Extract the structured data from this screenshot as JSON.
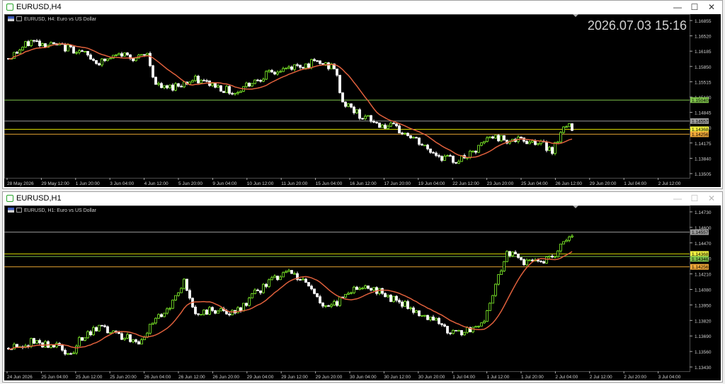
{
  "colors": {
    "bull": "#7ff02a",
    "bear": "#ffffff",
    "ma": "#e0603c",
    "bg": "#000000",
    "grid": "#4a4a4a",
    "green_line": "#7ec24a",
    "orange_line": "#e0a030",
    "gray_line": "#9a9a9a"
  },
  "windows": [
    {
      "title": "EURUSD,H4",
      "symbol_info": "EURUSD, H4:  Euro vs US Dollar",
      "clock": "2026.07.03 15:16",
      "controls": {
        "min": "—",
        "max": "☐",
        "close": "✕"
      },
      "price_axis": [
        "1.16855",
        "1.16520",
        "1.16185",
        "1.15850",
        "1.15515",
        "1.15180",
        "1.14845",
        "1.14510",
        "1.14175",
        "1.13840",
        "1.13505"
      ],
      "price_range": [
        1.1325,
        1.1697
      ],
      "time_labels": [
        "28 May 2026",
        "29 May 12:00",
        "1 Jun 20:00",
        "3 Jun 04:00",
        "4 Jun 12:00",
        "5 Jun 20:00",
        "9 Jun 04:00",
        "10 Jun 12:00",
        "11 Jun 20:00",
        "15 Jun 04:00",
        "16 Jun 12:00",
        "17 Jun 20:00",
        "19 Jun 04:00",
        "22 Jun 12:00",
        "23 Jun 20:00",
        "25 Jun 04:00",
        "26 Jun 12:00",
        "29 Jun 20:00",
        "1 Jul 04:00",
        "2 Jul 12:00"
      ],
      "levels": [
        {
          "price": 1.1504,
          "label": "1.15040",
          "color": "#7ec24a",
          "label_bg": "#7ec24a",
          "label_fg": "#000"
        },
        {
          "price": 1.14557,
          "label": "1.14557",
          "color": "#9a9a9a",
          "label_bg": "#9a9a9a",
          "label_fg": "#000"
        },
        {
          "price": 1.14368,
          "label": "1.14368",
          "color": "#d8d800",
          "label_bg": "#f0f040",
          "label_fg": "#000"
        },
        {
          "price": 1.14256,
          "label": "1.14256",
          "color": "#e0a030",
          "label_bg": "#f0a838",
          "label_fg": "#000"
        }
      ],
      "bars": 200,
      "anchors": [
        [
          0,
          1.16
        ],
        [
          8,
          1.164
        ],
        [
          16,
          1.163
        ],
        [
          24,
          1.162
        ],
        [
          32,
          1.159
        ],
        [
          40,
          1.161
        ],
        [
          46,
          1.16
        ],
        [
          49,
          1.161
        ],
        [
          52,
          1.154
        ],
        [
          55,
          1.153
        ],
        [
          60,
          1.154
        ],
        [
          66,
          1.155
        ],
        [
          72,
          1.154
        ],
        [
          80,
          1.152
        ],
        [
          84,
          1.154
        ],
        [
          90,
          1.156
        ],
        [
          100,
          1.158
        ],
        [
          108,
          1.159
        ],
        [
          115,
          1.158
        ],
        [
          118,
          1.15
        ],
        [
          124,
          1.147
        ],
        [
          130,
          1.145
        ],
        [
          136,
          1.144
        ],
        [
          142,
          1.142
        ],
        [
          148,
          1.139
        ],
        [
          154,
          1.137
        ],
        [
          158,
          1.1365
        ],
        [
          164,
          1.138
        ],
        [
          170,
          1.142
        ],
        [
          180,
          1.141
        ],
        [
          186,
          1.141
        ],
        [
          192,
          1.139
        ],
        [
          196,
          1.144
        ],
        [
          199,
          1.1443
        ]
      ]
    },
    {
      "title": "EURUSD,H1",
      "symbol_info": "EURUSD, H1:  Euro vs US Dollar",
      "controls": {
        "min": "—",
        "max": "☐",
        "close": "✕"
      },
      "price_axis": [
        "1.14730",
        "1.14600",
        "1.14470",
        "1.14340",
        "1.14210",
        "1.14080",
        "1.13950",
        "1.13820",
        "1.13690",
        "1.13560",
        "1.13430"
      ],
      "price_range": [
        1.1335,
        1.1477
      ],
      "time_labels": [
        "24 Jun 2026",
        "25 Jun 04:00",
        "25 Jun 12:00",
        "25 Jun 20:00",
        "26 Jun 04:00",
        "26 Jun 12:00",
        "26 Jun 20:00",
        "29 Jun 04:00",
        "29 Jun 12:00",
        "29 Jun 20:00",
        "30 Jun 04:00",
        "30 Jun 12:00",
        "30 Jun 20:00",
        "1 Jul 04:00",
        "1 Jul 12:00",
        "1 Jul 20:00",
        "2 Jul 04:00",
        "2 Jul 12:00",
        "2 Jul 20:00",
        "3 Jul 04:00"
      ],
      "levels": [
        {
          "price": 1.14557,
          "label": "1.14557",
          "color": "#9a9a9a",
          "label_bg": "#9a9a9a",
          "label_fg": "#000"
        },
        {
          "price": 1.14368,
          "label": "1.14368",
          "color": "#d8d800",
          "label_bg": "#f0f040",
          "label_fg": "#000"
        },
        {
          "price": 1.14346,
          "label": "1.14346",
          "color": "#7ec24a",
          "label_bg": "#7ec24a",
          "label_fg": "#000"
        },
        {
          "price": 1.14256,
          "label": "1.14256",
          "color": "#e0a030",
          "label_bg": "#f0a838",
          "label_fg": "#000"
        }
      ],
      "bars": 200,
      "anchors": [
        [
          0,
          1.1355
        ],
        [
          8,
          1.136
        ],
        [
          16,
          1.1358
        ],
        [
          22,
          1.135
        ],
        [
          26,
          1.1365
        ],
        [
          32,
          1.1372
        ],
        [
          40,
          1.1366
        ],
        [
          46,
          1.1362
        ],
        [
          52,
          1.1378
        ],
        [
          58,
          1.1395
        ],
        [
          62,
          1.1412
        ],
        [
          66,
          1.1385
        ],
        [
          72,
          1.1388
        ],
        [
          80,
          1.1384
        ],
        [
          86,
          1.14
        ],
        [
          92,
          1.1412
        ],
        [
          100,
          1.1422
        ],
        [
          106,
          1.141
        ],
        [
          110,
          1.1395
        ],
        [
          114,
          1.139
        ],
        [
          120,
          1.1405
        ],
        [
          126,
          1.141
        ],
        [
          134,
          1.14
        ],
        [
          140,
          1.1392
        ],
        [
          146,
          1.1385
        ],
        [
          150,
          1.138
        ],
        [
          156,
          1.137
        ],
        [
          162,
          1.137
        ],
        [
          168,
          1.1378
        ],
        [
          172,
          1.141
        ],
        [
          176,
          1.144
        ],
        [
          182,
          1.143
        ],
        [
          188,
          1.1428
        ],
        [
          194,
          1.144
        ],
        [
          199,
          1.1455
        ]
      ]
    }
  ]
}
